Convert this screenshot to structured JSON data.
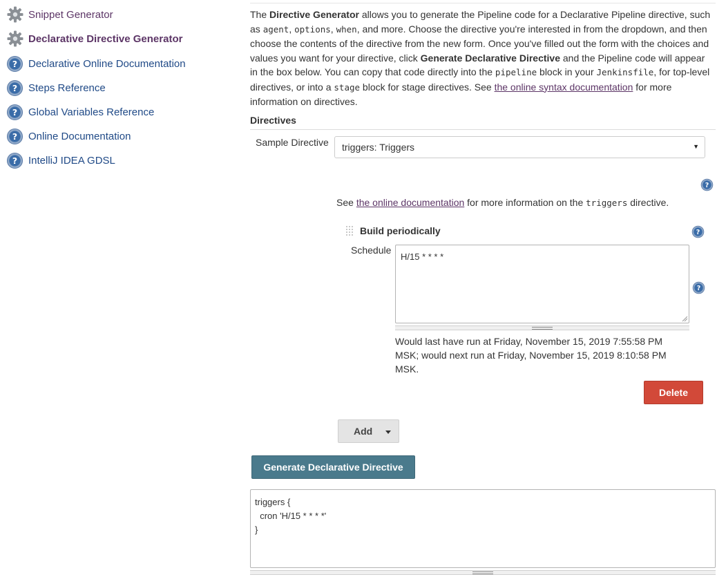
{
  "sidebar": {
    "items": [
      {
        "label": "Snippet Generator",
        "icon": "gear-icon"
      },
      {
        "label": "Declarative Directive Generator",
        "icon": "gear-icon",
        "active": true
      },
      {
        "label": "Declarative Online Documentation",
        "icon": "help-icon"
      },
      {
        "label": "Steps Reference",
        "icon": "help-icon"
      },
      {
        "label": "Global Variables Reference",
        "icon": "help-icon"
      },
      {
        "label": "Online Documentation",
        "icon": "help-icon"
      },
      {
        "label": "IntelliJ IDEA GDSL",
        "icon": "help-icon"
      }
    ]
  },
  "intro": {
    "t1": "The ",
    "b1": "Directive Generator",
    "t2": " allows you to generate the Pipeline code for a Declarative Pipeline directive, such as ",
    "c1": "agent",
    "t3": ", ",
    "c2": "options",
    "t4": ", ",
    "c3": "when",
    "t5": ", and more. Choose the directive you're interested in from the dropdown, and then choose the contents of the directive from the new form. Once you've filled out the form with the choices and values you want for your directive, click ",
    "b2": "Generate Declarative Directive",
    "t6": " and the Pipeline code will appear in the box below. You can copy that code directly into the ",
    "c4": "pipeline",
    "t7": " block in your ",
    "c5": "Jenkinsfile",
    "t8": ", for top-level directives, or into a ",
    "c6": "stage",
    "t9": " block for stage directives. See ",
    "link": "the online syntax documentation",
    "t10": " for more information on directives."
  },
  "directives": {
    "section_title": "Directives",
    "sample_label": "Sample Directive",
    "selected": "triggers: Triggers",
    "see_prefix": "See ",
    "see_link": "the online documentation",
    "see_mid": " for more information on the ",
    "see_code": "triggers",
    "see_suffix": " directive."
  },
  "trigger_block": {
    "title": "Build periodically",
    "schedule_label": "Schedule",
    "schedule_value": "H/15 * * * *",
    "info": "Would last have run at Friday, November 15, 2019 7:55:58 PM MSK; would next run at Friday, November 15, 2019 8:10:58 PM MSK.",
    "delete_label": "Delete"
  },
  "add_label": "Add",
  "generate_label": "Generate Declarative Directive",
  "output": "triggers {\n  cron 'H/15 * * * *'\n}",
  "colors": {
    "link": "#204a87",
    "active": "#5c3566",
    "delete": "#d24939",
    "generate": "#4a7a8c"
  }
}
